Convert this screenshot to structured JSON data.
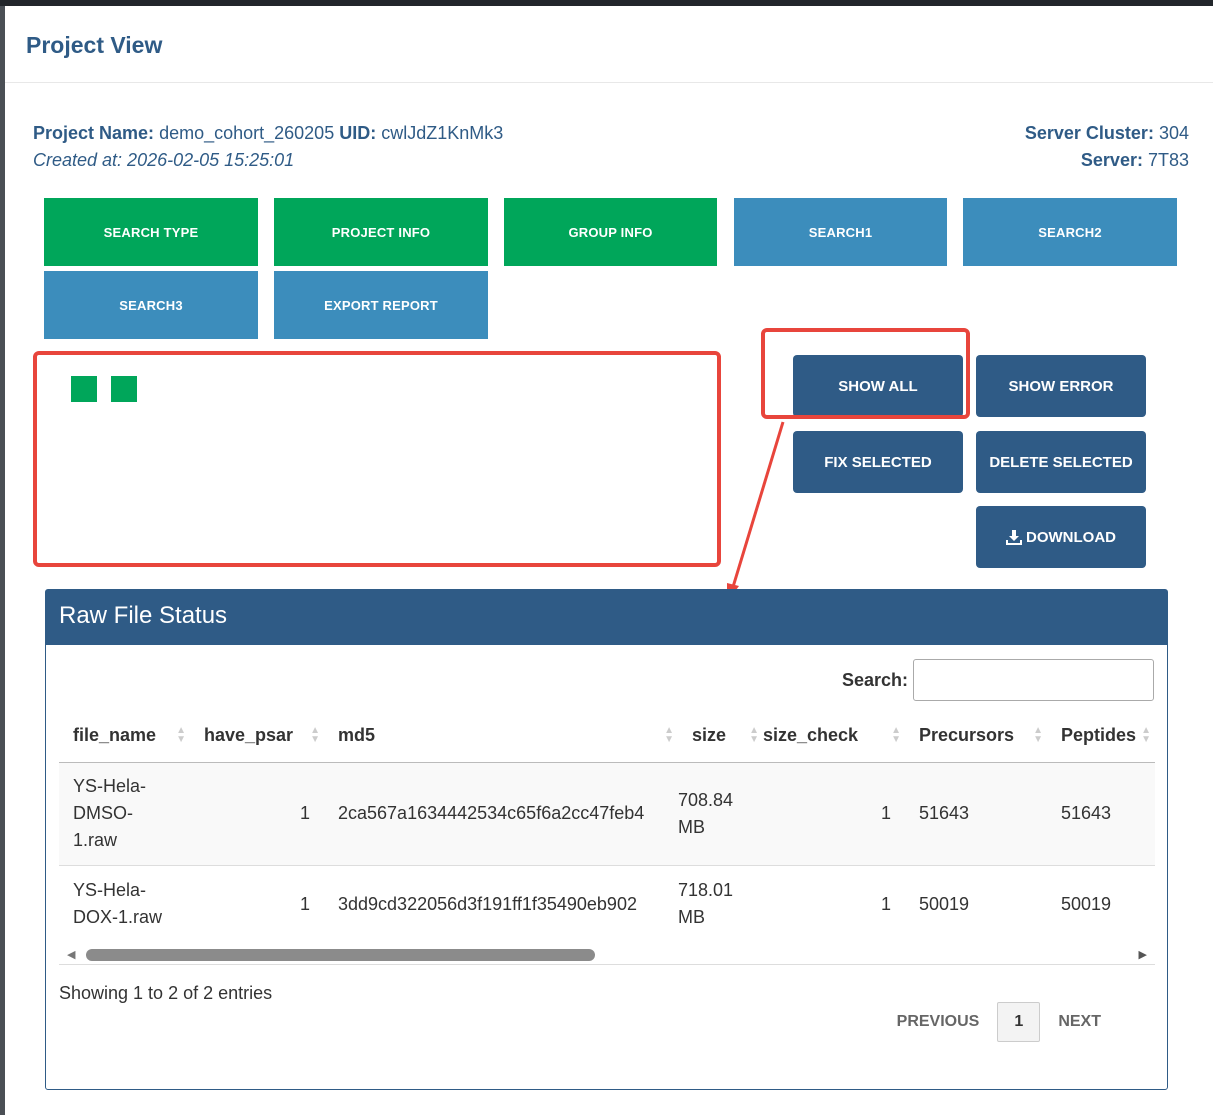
{
  "modal": {
    "title": "Project View"
  },
  "project": {
    "name_label": "Project Name:",
    "name": "demo_cohort_260205",
    "uid_label": "UID:",
    "uid": "cwlJdZ1KnMk3",
    "created": "Created at: 2026-02-05 15:25:01",
    "cluster_label": "Server Cluster:",
    "cluster": "304",
    "server_label": "Server:",
    "server": "7T83"
  },
  "tabs": [
    "SEARCH TYPE",
    "PROJECT INFO",
    "GROUP INFO",
    "SEARCH1",
    "SEARCH2",
    "SEARCH3",
    "EXPORT REPORT"
  ],
  "actions": {
    "show_all": "SHOW ALL",
    "show_error": "SHOW ERROR",
    "fix_selected": "FIX SELECTED",
    "delete_selected": "DELETE SELECTED",
    "download": "DOWNLOAD"
  },
  "panel": {
    "title": "Raw File Status",
    "search_label": "Search:",
    "search_value": "",
    "columns": [
      "file_name",
      "have_psar",
      "md5",
      "size",
      "size_check",
      "Precursors",
      "Peptides"
    ],
    "rows": [
      {
        "file_name_lines": [
          "YS-Hela-",
          "DMSO-",
          "1.raw"
        ],
        "have_psar": "1",
        "md5": "2ca567a1634442534c65f6a2cc47feb4",
        "size_lines": [
          "708.84",
          "MB"
        ],
        "size_check": "1",
        "precursors": "51643",
        "peptides": "51643"
      },
      {
        "file_name_lines": [
          "YS-Hela-",
          "DOX-1.raw"
        ],
        "have_psar": "1",
        "md5": "3dd9cd322056d3f191ff1f35490eb902",
        "size_lines": [
          "718.01",
          "MB"
        ],
        "size_check": "1",
        "precursors": "50019",
        "peptides": "50019"
      }
    ],
    "entries": "Showing 1 to 2 of 2 entries",
    "prev": "PREVIOUS",
    "page": "1",
    "next": "NEXT"
  },
  "colors": {
    "green": "#00a65a",
    "blue": "#3c8dbc",
    "navy": "#2f5b86",
    "highlight": "#e8453c"
  },
  "icons": {
    "download": "download-icon",
    "sort": "sort-icon"
  }
}
